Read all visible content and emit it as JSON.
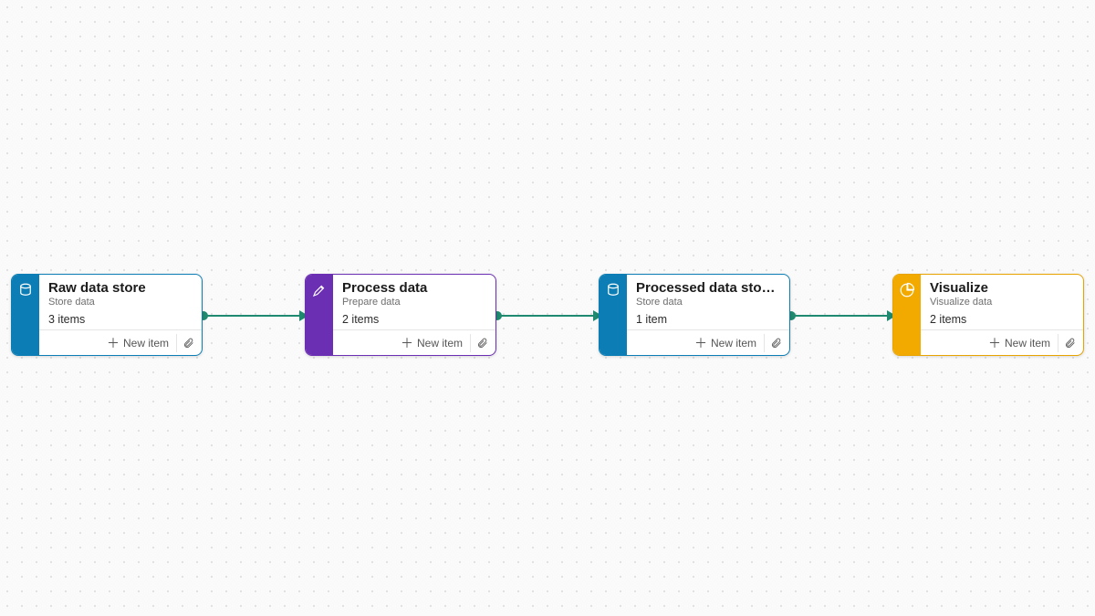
{
  "common": {
    "new_item_label": "New item"
  },
  "nodes": [
    {
      "title": "Raw data store",
      "subtitle": "Store data",
      "count_label": "3 items",
      "icon": "database-icon",
      "accent": "#0c7eb5"
    },
    {
      "title": "Process data",
      "subtitle": "Prepare data",
      "count_label": "2 items",
      "icon": "brush-icon",
      "accent": "#6b2fb3"
    },
    {
      "title": "Processed data sto…",
      "subtitle": "Store data",
      "count_label": "1 item",
      "icon": "database-icon",
      "accent": "#0c7eb5"
    },
    {
      "title": "Visualize",
      "subtitle": "Visualize data",
      "count_label": "2 items",
      "icon": "pie-chart-icon",
      "accent": "#f2a900"
    }
  ],
  "connections": [
    {
      "from": 0,
      "to": 1
    },
    {
      "from": 1,
      "to": 2
    },
    {
      "from": 2,
      "to": 3
    }
  ],
  "connector_color": "#1f8a70"
}
